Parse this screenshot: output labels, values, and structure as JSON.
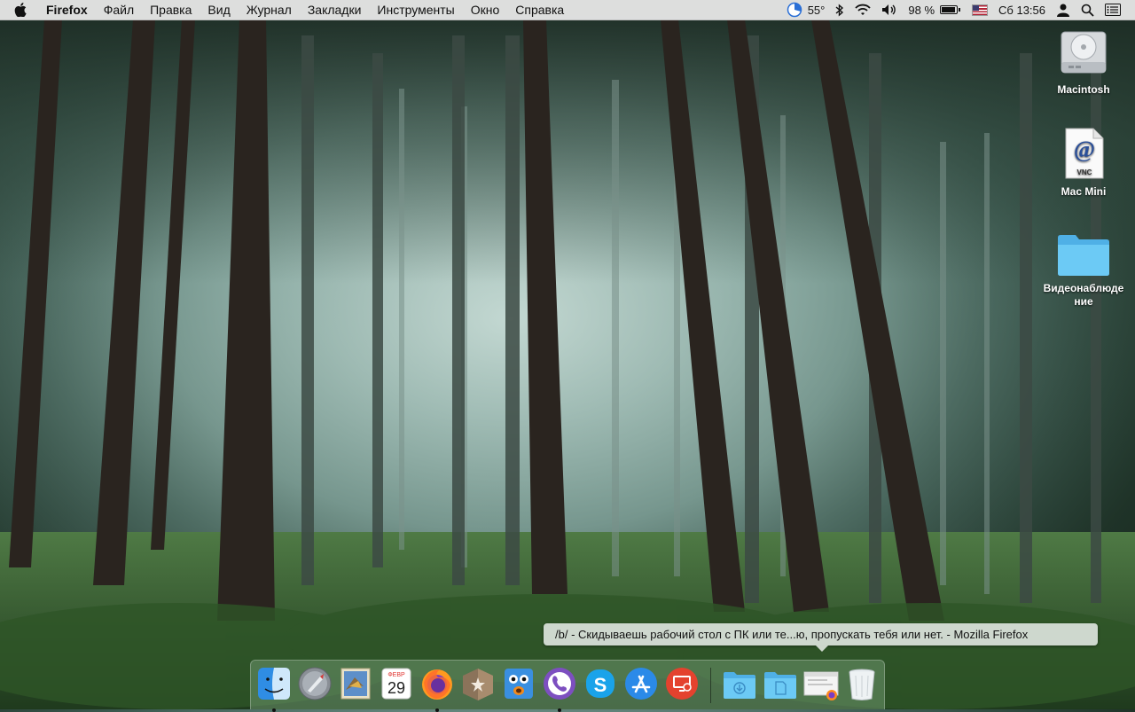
{
  "menubar": {
    "apple_icon": "apple-icon",
    "app_name": "Firefox",
    "menus": [
      "Файл",
      "Правка",
      "Вид",
      "Журнал",
      "Закладки",
      "Инструменты",
      "Окно",
      "Справка"
    ],
    "status": {
      "temperature": "55°",
      "battery_percent": "98 %",
      "battery_level": 0.98,
      "datetime": "Сб 13:56"
    }
  },
  "desktop": {
    "icons": [
      {
        "label": "Macintosh",
        "icon": "hard-drive-icon"
      },
      {
        "label": "Mac Mini",
        "icon": "vnc-file-icon",
        "badge": "VNC"
      },
      {
        "label": "Видеонаблюде ние",
        "icon": "folder-icon"
      }
    ]
  },
  "tooltip": {
    "text": "/b/ - Скидываешь рабочий стол с ПК или те...ю, пропускать тебя или нет. - Mozilla Firefox"
  },
  "dock": {
    "calendar_month": "ФЕВР",
    "calendar_day": "29",
    "items": [
      {
        "name": "Finder",
        "icon": "finder-icon",
        "running": true
      },
      {
        "name": "Launchpad",
        "icon": "launchpad-icon",
        "running": false
      },
      {
        "name": "Mail",
        "icon": "mail-icon",
        "running": false
      },
      {
        "name": "Calendar",
        "icon": "calendar-icon",
        "running": false
      },
      {
        "name": "Firefox",
        "icon": "firefox-icon",
        "running": true
      },
      {
        "name": "Reeder",
        "icon": "reeder-icon",
        "running": false
      },
      {
        "name": "Photo Booth",
        "icon": "photo-booth-icon",
        "running": false
      },
      {
        "name": "Viber",
        "icon": "viber-icon",
        "running": true
      },
      {
        "name": "Skype",
        "icon": "skype-icon",
        "running": false
      },
      {
        "name": "App Store",
        "icon": "app-store-icon",
        "running": false
      },
      {
        "name": "Screen Sharing",
        "icon": "screen-sharing-icon",
        "running": false
      },
      {
        "name": "Downloads",
        "icon": "downloads-folder-icon",
        "running": false
      },
      {
        "name": "Documents",
        "icon": "documents-folder-icon",
        "running": false
      },
      {
        "name": "Firefox Window",
        "icon": "firefox-window-icon",
        "running": false
      },
      {
        "name": "Trash",
        "icon": "trash-icon",
        "running": false
      }
    ]
  },
  "colors": {
    "menubar_bg": "#ececec",
    "folder_blue": "#5ec3f2",
    "dock_bg": "#6e966e"
  }
}
